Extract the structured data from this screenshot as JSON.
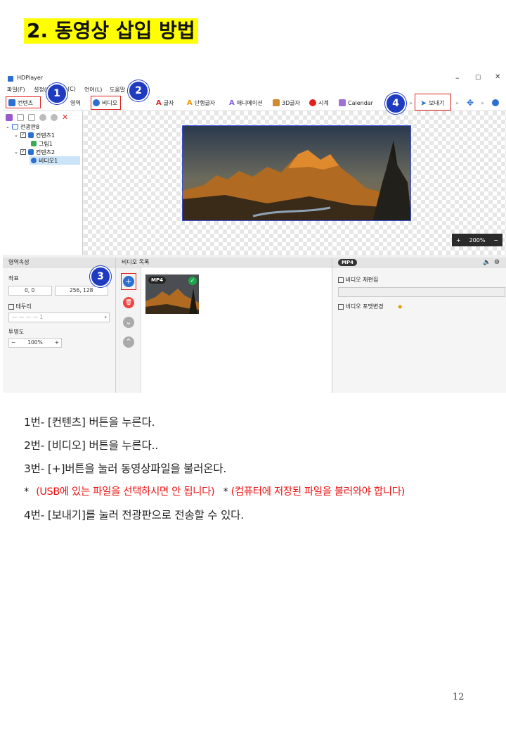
{
  "heading": "2. 동영상 삽입 방법",
  "app": {
    "title": "HDPlayer",
    "window_controls": [
      "–",
      "☐",
      "✕"
    ],
    "menu": [
      "파일(F)",
      "설정(S)",
      "(C)",
      "언어(L)",
      "도움말"
    ],
    "toolbar": {
      "content": "컨텐츠",
      "area": "영역",
      "video": "비디오",
      "text": "글자",
      "single_text": "단행글자",
      "animation": "애니메이션",
      "text3d": "3D글자",
      "clock": "시계",
      "calendar": "Calendar",
      "send": "보내기",
      "more": "»"
    },
    "tree": {
      "root": "전광판8",
      "content1": "컨텐츠1",
      "image1": "그림1",
      "content2": "컨텐츠2",
      "video1": "비디오1"
    },
    "zoom": {
      "minus": "−",
      "plus": "+",
      "value": "200%"
    },
    "area_panel": {
      "header": "영역속성",
      "coord_label": "좌표",
      "position": "0, 0",
      "size": "256, 128",
      "border_label": "테두리",
      "border_value": "1",
      "opacity_label": "투명도",
      "opacity_value": "100%",
      "minus": "−",
      "plus": "+"
    },
    "video_panel": {
      "header": "비디오 목록",
      "add": "+",
      "delete": "🗑",
      "down": "⌄",
      "up": "⌃",
      "badge": "MP4",
      "check": "✓"
    },
    "props_panel": {
      "badge": "MP4",
      "reedit": "비디오 재편집",
      "format_change": "비디오 포맷변경"
    }
  },
  "markers": [
    "1",
    "2",
    "3",
    "4"
  ],
  "instructions": [
    "1번- [컨텐츠] 버튼을 누른다.",
    "2번- [비디오] 버튼을 누른다..",
    "3번- [+]버튼을 눌러 동영상파일을 불러온다.",
    "4번- [보내기]를 눌러 전광판으로 전송할 수 있다."
  ],
  "note": {
    "star1": "*",
    "text1": "(USB에 있는 파일을 선택하시면 안 됩니다)",
    "star2": "*",
    "text2": "(컴퓨터에 저장된 파일을 불러와야 합니다)"
  },
  "page_number": "12",
  "colors": {
    "highlight": "#ffff00",
    "marker": "#1f3bbf",
    "red_box": "#e0201d",
    "note": "#ee1111"
  }
}
